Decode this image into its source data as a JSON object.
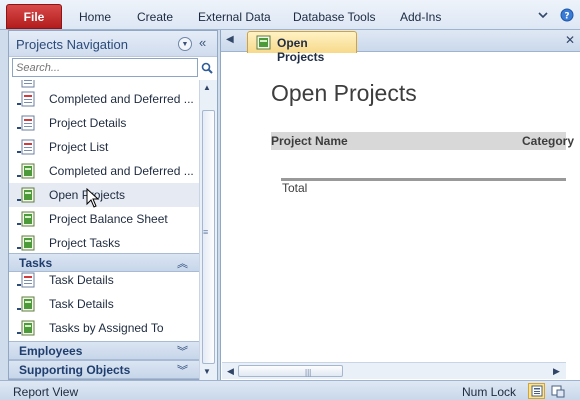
{
  "ribbon": {
    "file_label": "File",
    "tabs": [
      "Home",
      "Create",
      "External Data",
      "Database Tools",
      "Add-Ins"
    ],
    "accent": "#c0302f"
  },
  "nav": {
    "title": "Projects Navigation",
    "search_placeholder": "Search...",
    "items": [
      {
        "label": "Completed and Deferred ...",
        "icon": "report-icon"
      },
      {
        "label": "Project Details",
        "icon": "report-icon"
      },
      {
        "label": "Project List",
        "icon": "report-icon"
      },
      {
        "label": "Completed and Deferred ...",
        "icon": "form-icon"
      },
      {
        "label": "Open Projects",
        "icon": "form-icon",
        "selected": true
      },
      {
        "label": "Project Balance Sheet",
        "icon": "form-icon"
      },
      {
        "label": "Project Tasks",
        "icon": "form-icon"
      }
    ],
    "groups": {
      "tasks": {
        "label": "Tasks",
        "items": [
          {
            "label": "Task Details",
            "icon": "report-icon"
          },
          {
            "label": "Task Details",
            "icon": "form-icon"
          },
          {
            "label": "Tasks by Assigned To",
            "icon": "form-icon"
          }
        ]
      },
      "employees": {
        "label": "Employees"
      },
      "supporting": {
        "label": "Supporting Objects"
      }
    }
  },
  "document": {
    "tab_label": "Open Projects",
    "form_title": "Open Projects",
    "columns": [
      "Project Name",
      "Category"
    ],
    "total_label": "Total",
    "tab_color": "#f7d98b"
  },
  "status": {
    "left_text": "Report View",
    "num_lock": "Num Lock"
  }
}
